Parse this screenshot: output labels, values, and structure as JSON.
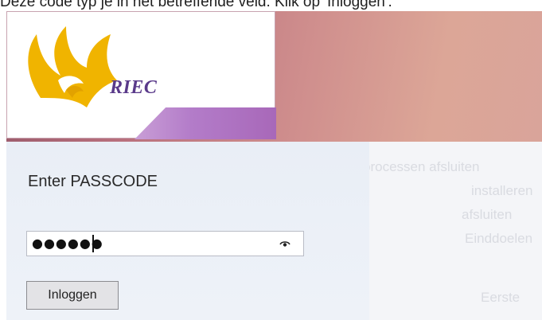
{
  "page": {
    "top_caption": "Deze code typ je in het betreffende veld. Klik op 'Inloggen'."
  },
  "header": {
    "logo_text": "RIEC",
    "logo_icon": "eagle-logo-icon",
    "logo_color": "#f0b400",
    "band_color": "#b37cc9"
  },
  "login": {
    "title": "Enter PASSCODE",
    "passcode_value": "●●●●●●",
    "eye_icon": "eye-icon",
    "button_label": "Inloggen"
  },
  "background_text": {
    "lines": [
      "processen afsluiten",
      "installeren",
      "afsluiten",
      "Einddoelen",
      "Eerste"
    ]
  }
}
